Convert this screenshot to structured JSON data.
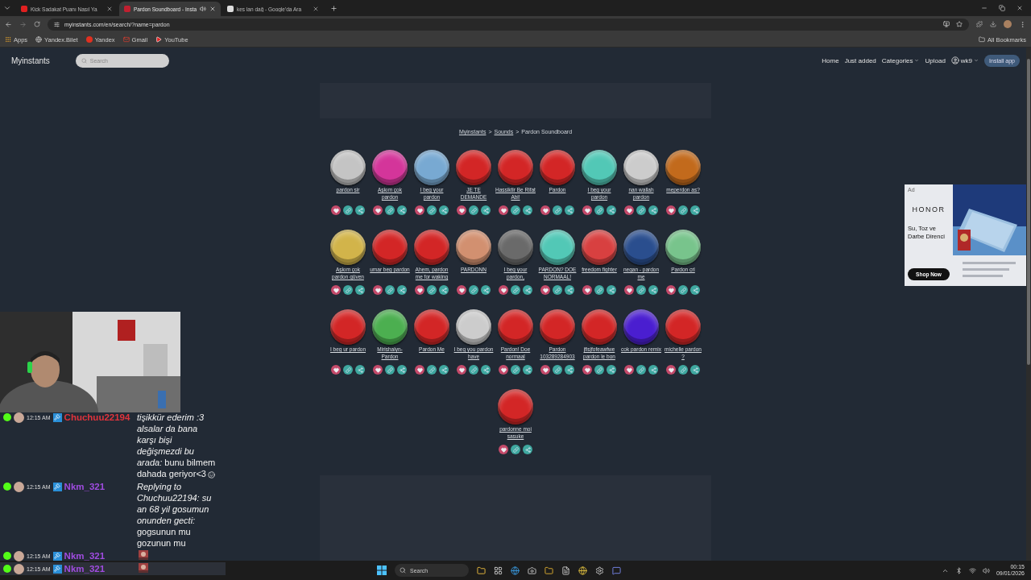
{
  "browser": {
    "tabs": [
      {
        "title": "Kick Sadakat Puanı Nasıl Ya",
        "selected": false,
        "kind": "video"
      },
      {
        "title": "Pardon Soundboard - Insta",
        "selected": true,
        "kind": "sound"
      },
      {
        "title": "kes lan dağ - Google'da Ara",
        "selected": false,
        "kind": "search"
      }
    ],
    "address": "myinstants.com/en/search/?name=pardon",
    "bookmarks": [
      {
        "label": "Apps",
        "kind": "apps"
      },
      {
        "label": "Yandex.Bilet",
        "kind": "globe"
      },
      {
        "label": "Yandex",
        "kind": "yandex"
      },
      {
        "label": "Gmail",
        "kind": "mail"
      },
      {
        "label": "YouTube",
        "kind": "video"
      }
    ],
    "all_bookmarks": "All Bookmarks"
  },
  "site": {
    "logo": "Myinstants",
    "search": {
      "placeholder": "Search"
    },
    "nav": [
      {
        "label": "Home",
        "kind": "link"
      },
      {
        "label": "Just added",
        "kind": "link"
      },
      {
        "label": "Categories",
        "kind": "dropdown"
      },
      {
        "label": "Upload",
        "kind": "link"
      },
      {
        "label": "wk9",
        "kind": "user"
      }
    ],
    "install": "Install app"
  },
  "breadcrumb": {
    "separator": ">",
    "items": [
      {
        "label": "Myinstants",
        "kind": "link"
      },
      {
        "label": "Sounds",
        "kind": "link"
      },
      {
        "label": "Pardon Soundboard",
        "kind": "current"
      }
    ]
  },
  "sounds": [
    {
      "label": "pardon sir",
      "color": "#c4c4c4"
    },
    {
      "label": "Aşkım çok pardon",
      "color": "#d4359a"
    },
    {
      "label": "I beg your pardon",
      "color": "#78a9d2"
    },
    {
      "label": "JE TE DEMANDE",
      "color": "#d32626"
    },
    {
      "label": "Hassiktir Be Rifat Abi!",
      "color": "#d32626"
    },
    {
      "label": "Pardon",
      "color": "#d32626"
    },
    {
      "label": "I beg your pardon",
      "color": "#52c8b6"
    },
    {
      "label": "nan wallah pardon",
      "color": "#cccccc"
    },
    {
      "label": "meperdon as?",
      "color": "#c26a1c"
    },
    {
      "label": "Aşkım çok pardon güven",
      "color": "#d2b44a"
    },
    {
      "label": "umar beg pardon",
      "color": "#d32626"
    },
    {
      "label": "Ahem, pardon me for waking",
      "color": "#d32626"
    },
    {
      "label": "PARDONN",
      "color": "#d29070"
    },
    {
      "label": "I beg your pardon,",
      "color": "#6a6a6a"
    },
    {
      "label": "PARDON? DOE NORMAAL!",
      "color": "#52c8b6"
    },
    {
      "label": "freedom fighter",
      "color": "#d84040"
    },
    {
      "label": "negan - pardon me",
      "color": "#2a4e8e"
    },
    {
      "label": "Pardon crl",
      "color": "#78c48c"
    },
    {
      "label": "I beg ur pardon",
      "color": "#d32626"
    },
    {
      "label": "Mirishalyn-Pardon",
      "color": "#4caf50"
    },
    {
      "label": "Pardon Me",
      "color": "#d32626"
    },
    {
      "label": "I beg you pardon have",
      "color": "#cccccc"
    },
    {
      "label": "Pardon! Doe normaal",
      "color": "#d32626"
    },
    {
      "label": "Pardon 103289284903",
      "color": "#d32626"
    },
    {
      "label": "jfisjfofeawfwe pardon le bon",
      "color": "#d32626"
    },
    {
      "label": "cok pardon remix",
      "color": "#4a1ed0"
    },
    {
      "label": "michelle pardon ?",
      "color": "#d32626"
    },
    {
      "label": "pardonne moi sasuke",
      "color": "#d32626"
    }
  ],
  "ad": {
    "badge": "Ad",
    "brand": "HONOR",
    "tagline": "Su, Toz ve Darbe Direnci",
    "cta": "Shop Now"
  },
  "chat": [
    {
      "time": "12:15 AM",
      "user": "Chuchuu22194",
      "color": "#e0343c",
      "kind": "text",
      "text": "*tişikkür ederim :3 alsalar da bana karşı bişi değişmezdi bu arada:* bunu bilmem dahada geriyor<3",
      "emoji": true
    },
    {
      "time": "12:15 AM",
      "user": "Nkm_321",
      "color": "#a04ce0",
      "kind": "text",
      "text": "*Replying to Chuchuu22194: su an 68 yil gosumun onunden gecti:* gogsunun mu gozunun mu"
    },
    {
      "time": "12:15 AM",
      "user": "Nkm_321",
      "color": "#a04ce0",
      "kind": "emote"
    },
    {
      "time": "12:15 AM",
      "user": "Nkm_321",
      "color": "#a04ce0",
      "kind": "emote"
    }
  ],
  "taskbar": {
    "search": {
      "placeholder": "Search"
    },
    "time": "00:15",
    "date": "09/01/2026"
  }
}
